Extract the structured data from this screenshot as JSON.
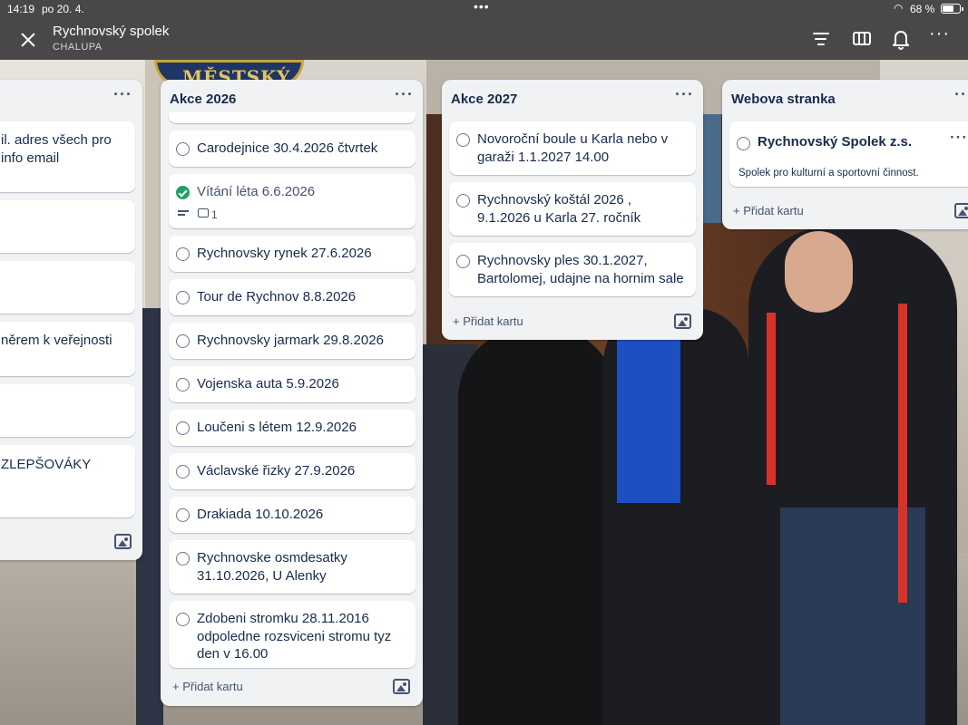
{
  "status": {
    "time": "14:19",
    "date": "po 20. 4.",
    "battery": "68 %",
    "battery_level": 0.68
  },
  "header": {
    "title": "Rychnovský spolek",
    "subtitle": "CHALUPA"
  },
  "background_sign": "MĚSTSKÝ",
  "lists": [
    {
      "name": "",
      "cards": [
        "il. adres všech pro info email",
        "",
        "",
        "něrem k veřejnosti",
        "",
        "ZLEPŠOVÁKY"
      ]
    },
    {
      "name": "Akce 2026",
      "cards": [
        "Carodejnice 30.4.2026 čtvrtek",
        "Vítání léta 6.6.2026",
        "Rychnovsky rynek 27.6.2026",
        "Tour de Rychnov  8.8.2026",
        "Rychnovsky jarmark 29.8.2026",
        "Vojenska auta  5.9.2026",
        "Loučeni s létem  12.9.2026",
        "Václavské řizky  27.9.2026",
        "Drakiada 10.10.2026",
        "Rychnovske osmdesatky 31.10.2026, U Alenky",
        "Zdobeni stromku 28.11.2016 odpoledne  rozsviceni stromu tyz den v 16.00"
      ],
      "comment_count": "1",
      "add_card": "+ Přidat kartu"
    },
    {
      "name": "Akce 2027",
      "cards": [
        "Novoroční boule u Karla nebo v garaži  1.1.2027 14.00",
        "Rychnovský koštál 2026 , 9.1.2026 u Karla  27. ročník",
        "Rychnovsky ples  30.1.2027, Bartolomej, udajne na hornim sale"
      ],
      "add_card": "+ Přidat kartu"
    },
    {
      "name": "Webova stranka",
      "cards": [
        {
          "title": "Rychnovský Spolek z.s.",
          "description": "Spolek pro kulturní a sportovní činnost."
        }
      ],
      "add_card": "+ Přidat kartu"
    }
  ],
  "icons": [
    "close-icon",
    "filter-icon",
    "board-view-icon",
    "bell-icon",
    "more-icon",
    "image-icon",
    "checkbox-icon",
    "description-icon",
    "comment-icon"
  ],
  "colors": {
    "complete_green": "#22a06b",
    "topbar": "#3c3e42",
    "list_bg": "#f1f2f4"
  }
}
